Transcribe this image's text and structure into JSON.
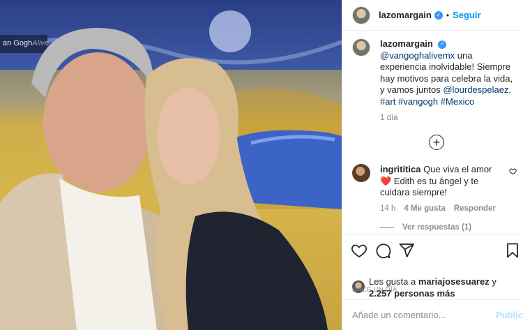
{
  "photo": {
    "sign_text": "an Gogh",
    "sign_suffix": "Alive"
  },
  "header": {
    "username": "lazomargain",
    "separator": "•",
    "follow_label": "Seguir"
  },
  "caption": {
    "username": "lazomargain",
    "mention": "@vangoghalivemx",
    "text1": " una experiencia inolvidable! Siempre hay motivos para celebra la vida, y vamos juntos ",
    "mention2": "@lourdespelaez",
    "text2": ". ",
    "tag1": "#art",
    "tag2": "#vangogh",
    "tag3": "#Mexico",
    "time": "1 día"
  },
  "comment": {
    "username": "ingrititica",
    "text": " Que viva el amor❤️ Edith es tu ángel y te cuidara siempre!",
    "time": "14 h",
    "likes": "4 Me gusta",
    "reply": "Responder",
    "view_replies": "Ver respuestas (1)"
  },
  "likes": {
    "prefix": "Les gusta a ",
    "user": "mariajosesuarez",
    "mid": " y",
    "count": "2.257 personas más"
  },
  "timestamp": "HACE UN DÍA",
  "add_comment": {
    "placeholder": "Añade un comentario...",
    "post_label": "Publicar"
  },
  "colors": {
    "link": "#00376b",
    "accent": "#0095f6",
    "verified": "#3897f0"
  }
}
